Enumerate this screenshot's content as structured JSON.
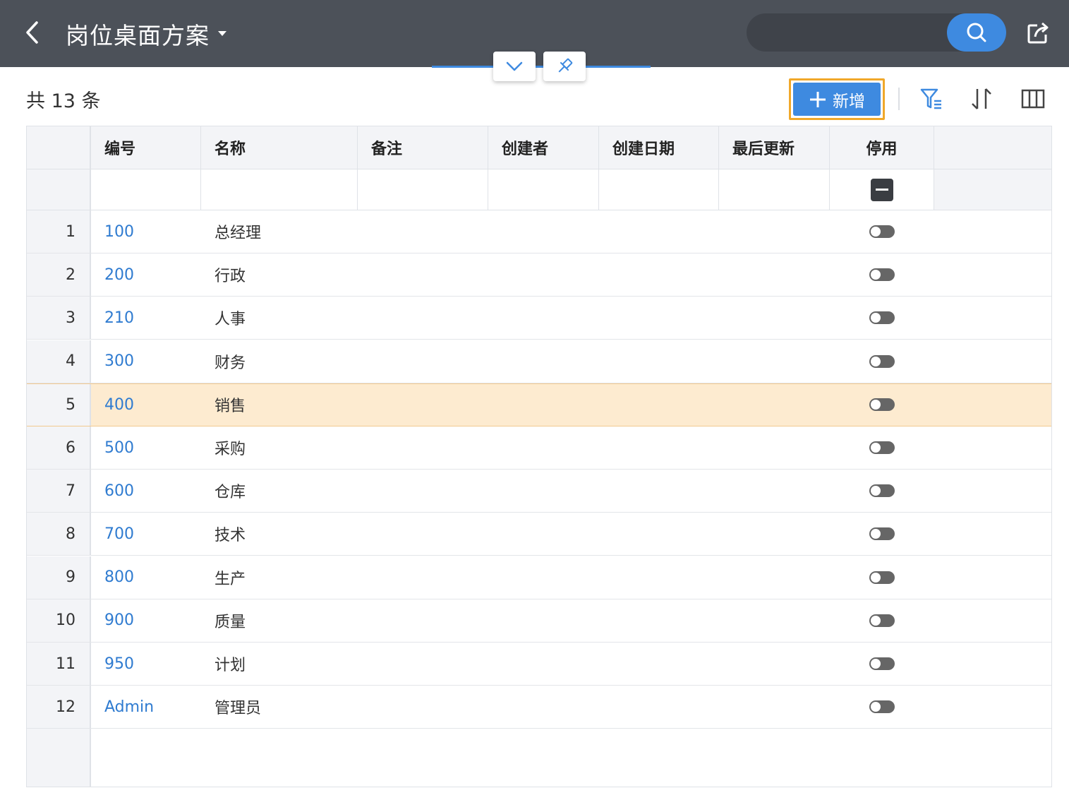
{
  "header": {
    "title": "岗位桌面方案",
    "search": {
      "value": "",
      "placeholder": ""
    }
  },
  "toolbar": {
    "count_text": "共 13 条",
    "add_label": "新增"
  },
  "table": {
    "columns": [
      "编号",
      "名称",
      "备注",
      "创建者",
      "创建日期",
      "最后更新",
      "停用"
    ],
    "rows": [
      {
        "n": "1",
        "code": "100",
        "name": "总经理",
        "disabled": false
      },
      {
        "n": "2",
        "code": "200",
        "name": "行政",
        "disabled": false
      },
      {
        "n": "3",
        "code": "210",
        "name": "人事",
        "disabled": false
      },
      {
        "n": "4",
        "code": "300",
        "name": "财务",
        "disabled": false
      },
      {
        "n": "5",
        "code": "400",
        "name": "销售",
        "disabled": false
      },
      {
        "n": "6",
        "code": "500",
        "name": "采购",
        "disabled": false
      },
      {
        "n": "7",
        "code": "600",
        "name": "仓库",
        "disabled": false
      },
      {
        "n": "8",
        "code": "700",
        "name": "技术",
        "disabled": false
      },
      {
        "n": "9",
        "code": "800",
        "name": "生产",
        "disabled": false
      },
      {
        "n": "10",
        "code": "900",
        "name": "质量",
        "disabled": false
      },
      {
        "n": "11",
        "code": "950",
        "name": "计划",
        "disabled": false
      },
      {
        "n": "12",
        "code": "Admin",
        "name": "管理员",
        "disabled": false
      }
    ],
    "selected_row": "5"
  },
  "colors": {
    "header_bg": "#4c5159",
    "accent": "#3e8ae0",
    "highlight_border": "#f0a82a",
    "selected_row_bg": "#fdebd0",
    "link": "#2f7bd0"
  },
  "icons": {
    "back": "chevron-left-icon",
    "title_dropdown": "caret-down-icon",
    "search": "search-icon",
    "share": "share-icon",
    "collapse": "chevron-down-icon",
    "pin": "pin-icon",
    "add": "plus-icon",
    "filter": "filter-icon",
    "sort": "sort-icon",
    "columns": "columns-icon",
    "toggle": "toggle-switch-icon"
  }
}
